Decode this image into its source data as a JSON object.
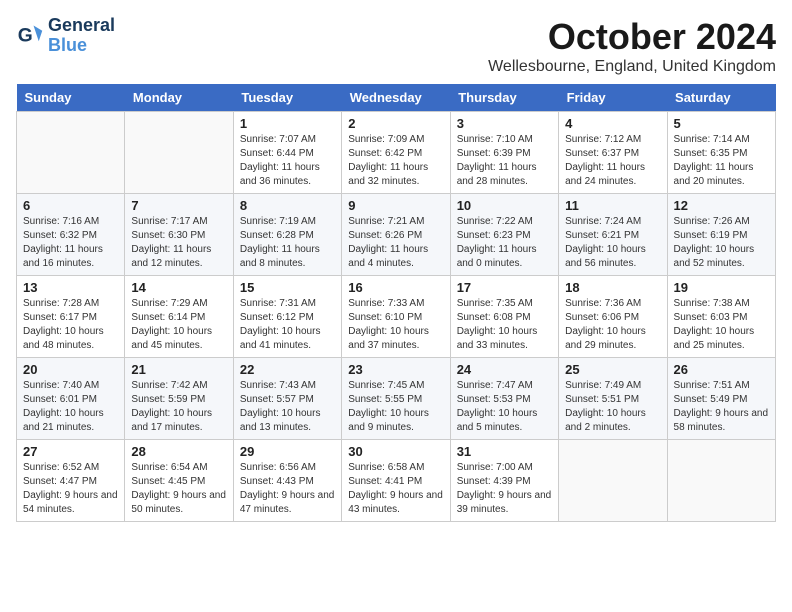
{
  "header": {
    "logo_line1": "General",
    "logo_line2": "Blue",
    "month": "October 2024",
    "location": "Wellesbourne, England, United Kingdom"
  },
  "days_of_week": [
    "Sunday",
    "Monday",
    "Tuesday",
    "Wednesday",
    "Thursday",
    "Friday",
    "Saturday"
  ],
  "weeks": [
    [
      {
        "day": "",
        "info": ""
      },
      {
        "day": "",
        "info": ""
      },
      {
        "day": "1",
        "info": "Sunrise: 7:07 AM\nSunset: 6:44 PM\nDaylight: 11 hours and 36 minutes."
      },
      {
        "day": "2",
        "info": "Sunrise: 7:09 AM\nSunset: 6:42 PM\nDaylight: 11 hours and 32 minutes."
      },
      {
        "day": "3",
        "info": "Sunrise: 7:10 AM\nSunset: 6:39 PM\nDaylight: 11 hours and 28 minutes."
      },
      {
        "day": "4",
        "info": "Sunrise: 7:12 AM\nSunset: 6:37 PM\nDaylight: 11 hours and 24 minutes."
      },
      {
        "day": "5",
        "info": "Sunrise: 7:14 AM\nSunset: 6:35 PM\nDaylight: 11 hours and 20 minutes."
      }
    ],
    [
      {
        "day": "6",
        "info": "Sunrise: 7:16 AM\nSunset: 6:32 PM\nDaylight: 11 hours and 16 minutes."
      },
      {
        "day": "7",
        "info": "Sunrise: 7:17 AM\nSunset: 6:30 PM\nDaylight: 11 hours and 12 minutes."
      },
      {
        "day": "8",
        "info": "Sunrise: 7:19 AM\nSunset: 6:28 PM\nDaylight: 11 hours and 8 minutes."
      },
      {
        "day": "9",
        "info": "Sunrise: 7:21 AM\nSunset: 6:26 PM\nDaylight: 11 hours and 4 minutes."
      },
      {
        "day": "10",
        "info": "Sunrise: 7:22 AM\nSunset: 6:23 PM\nDaylight: 11 hours and 0 minutes."
      },
      {
        "day": "11",
        "info": "Sunrise: 7:24 AM\nSunset: 6:21 PM\nDaylight: 10 hours and 56 minutes."
      },
      {
        "day": "12",
        "info": "Sunrise: 7:26 AM\nSunset: 6:19 PM\nDaylight: 10 hours and 52 minutes."
      }
    ],
    [
      {
        "day": "13",
        "info": "Sunrise: 7:28 AM\nSunset: 6:17 PM\nDaylight: 10 hours and 48 minutes."
      },
      {
        "day": "14",
        "info": "Sunrise: 7:29 AM\nSunset: 6:14 PM\nDaylight: 10 hours and 45 minutes."
      },
      {
        "day": "15",
        "info": "Sunrise: 7:31 AM\nSunset: 6:12 PM\nDaylight: 10 hours and 41 minutes."
      },
      {
        "day": "16",
        "info": "Sunrise: 7:33 AM\nSunset: 6:10 PM\nDaylight: 10 hours and 37 minutes."
      },
      {
        "day": "17",
        "info": "Sunrise: 7:35 AM\nSunset: 6:08 PM\nDaylight: 10 hours and 33 minutes."
      },
      {
        "day": "18",
        "info": "Sunrise: 7:36 AM\nSunset: 6:06 PM\nDaylight: 10 hours and 29 minutes."
      },
      {
        "day": "19",
        "info": "Sunrise: 7:38 AM\nSunset: 6:03 PM\nDaylight: 10 hours and 25 minutes."
      }
    ],
    [
      {
        "day": "20",
        "info": "Sunrise: 7:40 AM\nSunset: 6:01 PM\nDaylight: 10 hours and 21 minutes."
      },
      {
        "day": "21",
        "info": "Sunrise: 7:42 AM\nSunset: 5:59 PM\nDaylight: 10 hours and 17 minutes."
      },
      {
        "day": "22",
        "info": "Sunrise: 7:43 AM\nSunset: 5:57 PM\nDaylight: 10 hours and 13 minutes."
      },
      {
        "day": "23",
        "info": "Sunrise: 7:45 AM\nSunset: 5:55 PM\nDaylight: 10 hours and 9 minutes."
      },
      {
        "day": "24",
        "info": "Sunrise: 7:47 AM\nSunset: 5:53 PM\nDaylight: 10 hours and 5 minutes."
      },
      {
        "day": "25",
        "info": "Sunrise: 7:49 AM\nSunset: 5:51 PM\nDaylight: 10 hours and 2 minutes."
      },
      {
        "day": "26",
        "info": "Sunrise: 7:51 AM\nSunset: 5:49 PM\nDaylight: 9 hours and 58 minutes."
      }
    ],
    [
      {
        "day": "27",
        "info": "Sunrise: 6:52 AM\nSunset: 4:47 PM\nDaylight: 9 hours and 54 minutes."
      },
      {
        "day": "28",
        "info": "Sunrise: 6:54 AM\nSunset: 4:45 PM\nDaylight: 9 hours and 50 minutes."
      },
      {
        "day": "29",
        "info": "Sunrise: 6:56 AM\nSunset: 4:43 PM\nDaylight: 9 hours and 47 minutes."
      },
      {
        "day": "30",
        "info": "Sunrise: 6:58 AM\nSunset: 4:41 PM\nDaylight: 9 hours and 43 minutes."
      },
      {
        "day": "31",
        "info": "Sunrise: 7:00 AM\nSunset: 4:39 PM\nDaylight: 9 hours and 39 minutes."
      },
      {
        "day": "",
        "info": ""
      },
      {
        "day": "",
        "info": ""
      }
    ]
  ]
}
